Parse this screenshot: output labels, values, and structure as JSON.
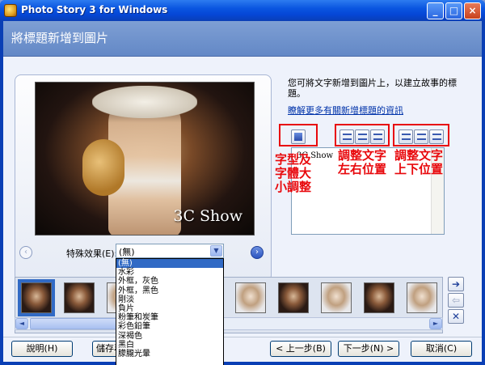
{
  "window": {
    "title": "Photo Story 3 for Windows",
    "minimize": "_",
    "maximize": "□",
    "close": "×"
  },
  "header": {
    "title": "將標題新增到圖片"
  },
  "preview": {
    "caption": "3C Show",
    "prev_arrow": "‹",
    "next_arrow": "›"
  },
  "effects": {
    "label": "特殊效果(E):",
    "selected": "(無)",
    "options": [
      "(無)",
      "水彩",
      "外框，灰色",
      "外框，黑色",
      "剛淡",
      "負片",
      "粉筆和炭筆",
      "彩色鉛筆",
      "深褐色",
      "黑白",
      "朦朧光暈"
    ]
  },
  "instructions": {
    "text": "您可將文字新增到圖片上，以建立故事的標題。",
    "link": "瞭解更多有關新增標題的資訊"
  },
  "editor": {
    "text": "3C Show"
  },
  "annotations": {
    "font": "字型及字體大小調整",
    "horizontal": "調整文字左右位置",
    "vertical": "調整文字上下位置"
  },
  "filmstrip": {
    "left_arrow": "◄",
    "right_arrow": "►",
    "move_right": "➔",
    "move_left": "⇦",
    "delete": "✕"
  },
  "buttons": {
    "help": "說明(H)",
    "save_project": "儲存專案(S)...",
    "back": "< 上一步(B)",
    "next": "下一步(N) >",
    "cancel": "取消(C)"
  },
  "colors": {
    "annotation": "#e8080c",
    "selection": "#316ac5",
    "header": "#6388c6"
  }
}
